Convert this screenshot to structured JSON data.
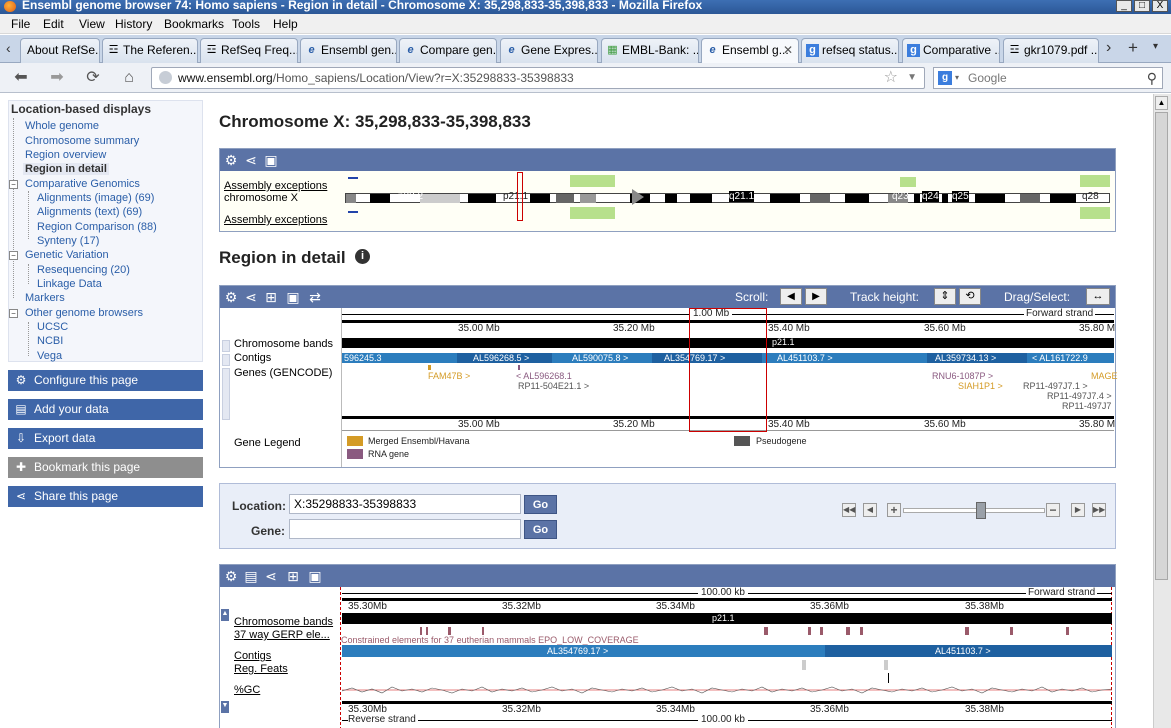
{
  "window": {
    "title": "Ensembl genome browser 74: Homo sapiens - Region in detail - Chromosome X: 35,298,833-35,398,833 - Mozilla Firefox",
    "controls": [
      "_",
      "□",
      "X"
    ]
  },
  "menu": [
    "File",
    "Edit",
    "View",
    "History",
    "Bookmarks",
    "Tools",
    "Help"
  ],
  "tabs": [
    "About RefSe...",
    "The Referen...",
    "RefSeq Freq...",
    "Ensembl gen...",
    "Compare gen...",
    "Gene Expres...",
    "EMBL-Bank: ...",
    "Ensembl g...",
    "refseq status...",
    "Comparative ...",
    "gkr1079.pdf ..."
  ],
  "nav": {
    "url_domain": "www.ensembl.org",
    "url_path": "/Homo_sapiens/Location/View?r=X:35298833-35398833",
    "search_placeholder": "Google"
  },
  "leftnav": {
    "heading": "Location-based displays",
    "items": [
      "Whole genome",
      "Chromosome summary",
      "Region overview",
      "Region in detail",
      "Comparative Genomics",
      "Alignments (image) (69)",
      "Alignments (text) (69)",
      "Region Comparison (88)",
      "Synteny (17)",
      "Genetic Variation",
      "Resequencing (20)",
      "Linkage Data",
      "Markers",
      "Other genome browsers",
      "UCSC",
      "NCBI",
      "Vega"
    ],
    "actions": [
      "Configure this page",
      "Add your data",
      "Export data",
      "Bookmark this page",
      "Share this page"
    ]
  },
  "page": {
    "title": "Chromosome X: 35,298,833-35,398,833",
    "section": "Region in detail"
  },
  "overview": {
    "labels": [
      "Assembly exceptions",
      "chromosome X",
      "Assembly exceptions"
    ],
    "bands": [
      "p22.2",
      "p21.1",
      "q21.1",
      "q23",
      "q24",
      "q25",
      "q28"
    ]
  },
  "detail": {
    "controls": {
      "scroll": "Scroll:",
      "track_height": "Track height:",
      "drag_select": "Drag/Select:"
    },
    "scale_label": "1.00 Mb",
    "strand": "Forward strand",
    "ticks": [
      "35.00 Mb",
      "35.20 Mb",
      "35.40 Mb",
      "35.60 Mb",
      "35.80 M"
    ],
    "track_labels": [
      "Chromosome bands",
      "Contigs",
      "Genes (GENCODE)",
      "Gene Legend"
    ],
    "band_label": "p21.1",
    "contigs": [
      "596245.3",
      "AL596268.5 >",
      "AL590075.8 >",
      "AL354769.17 >",
      "AL451103.7 >",
      "AL359734.13 >",
      "< AL161722.9"
    ],
    "genes": [
      "FAM47B >",
      "< AL596268.1",
      "RP11-504E21.1 >",
      "RNU6-1087P >",
      "SIAH1P1 >",
      "RP11-497J7.1 >",
      "RP11-497J7.4 >",
      "RP11-497J7",
      "MAGE"
    ],
    "legend": [
      "Merged Ensembl/Havana",
      "RNA gene",
      "Pseudogene"
    ],
    "legend_colors": [
      "#d49b26",
      "#8a5a80",
      "#555555"
    ]
  },
  "location_form": {
    "location_label": "Location:",
    "location_value": "X:35298833-35398833",
    "gene_label": "Gene:",
    "go": "Go"
  },
  "zoom": {
    "level": 0.55
  },
  "bottom": {
    "scale_label": "100.00 kb",
    "strand": "Forward strand",
    "reverse_strand": "Reverse strand",
    "ticks": [
      "35.30Mb",
      "35.32Mb",
      "35.34Mb",
      "35.36Mb",
      "35.38Mb"
    ],
    "track_labels": [
      "Chromosome bands",
      "37 way GERP ele...",
      "Contigs",
      "Reg. Feats",
      "%GC"
    ],
    "band_label": "p21.1",
    "gerp_label": "Constrained elements for 37 eutherian mammals EPO_LOW_COVERAGE",
    "contigs": [
      "AL354769.17 >",
      "AL451103.7 >"
    ]
  }
}
